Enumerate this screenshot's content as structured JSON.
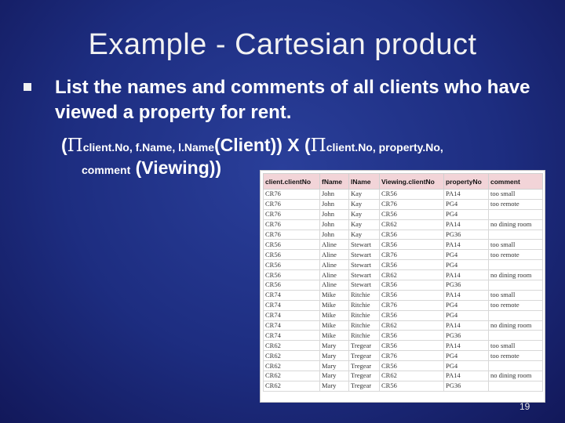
{
  "title": "Example - Cartesian product",
  "bullet": "List the names and comments of all clients who have viewed a property for rent.",
  "expression": {
    "open1": "(",
    "pi": "Π",
    "proj1_attrs": "client.No, f.Name, l.Name",
    "rel1": "(Client)) X (",
    "proj2_attrs": "client.No, property.No,",
    "proj2_attrs_cont": "comment",
    "rel2": "(Viewing))"
  },
  "table": {
    "headers": [
      "client.clientNo",
      "fName",
      "lName",
      "Viewing.clientNo",
      "propertyNo",
      "comment"
    ],
    "rows": [
      [
        "CR76",
        "John",
        "Kay",
        "CR56",
        "PA14",
        "too small"
      ],
      [
        "CR76",
        "John",
        "Kay",
        "CR76",
        "PG4",
        "too remote"
      ],
      [
        "CR76",
        "John",
        "Kay",
        "CR56",
        "PG4",
        ""
      ],
      [
        "CR76",
        "John",
        "Kay",
        "CR62",
        "PA14",
        "no dining room"
      ],
      [
        "CR76",
        "John",
        "Kay",
        "CR56",
        "PG36",
        ""
      ],
      [
        "CR56",
        "Aline",
        "Stewart",
        "CR56",
        "PA14",
        "too small"
      ],
      [
        "CR56",
        "Aline",
        "Stewart",
        "CR76",
        "PG4",
        "too remote"
      ],
      [
        "CR56",
        "Aline",
        "Stewart",
        "CR56",
        "PG4",
        ""
      ],
      [
        "CR56",
        "Aline",
        "Stewart",
        "CR62",
        "PA14",
        "no dining room"
      ],
      [
        "CR56",
        "Aline",
        "Stewart",
        "CR56",
        "PG36",
        ""
      ],
      [
        "CR74",
        "Mike",
        "Ritchie",
        "CR56",
        "PA14",
        "too small"
      ],
      [
        "CR74",
        "Mike",
        "Ritchie",
        "CR76",
        "PG4",
        "too remote"
      ],
      [
        "CR74",
        "Mike",
        "Ritchie",
        "CR56",
        "PG4",
        ""
      ],
      [
        "CR74",
        "Mike",
        "Ritchie",
        "CR62",
        "PA14",
        "no dining room"
      ],
      [
        "CR74",
        "Mike",
        "Ritchie",
        "CR56",
        "PG36",
        ""
      ],
      [
        "CR62",
        "Mary",
        "Tregear",
        "CR56",
        "PA14",
        "too small"
      ],
      [
        "CR62",
        "Mary",
        "Tregear",
        "CR76",
        "PG4",
        "too remote"
      ],
      [
        "CR62",
        "Mary",
        "Tregear",
        "CR56",
        "PG4",
        ""
      ],
      [
        "CR62",
        "Mary",
        "Tregear",
        "CR62",
        "PA14",
        "no dining room"
      ],
      [
        "CR62",
        "Mary",
        "Tregear",
        "CR56",
        "PG36",
        ""
      ]
    ]
  },
  "page_number": "19",
  "colors": {
    "background": "#1d2d80",
    "table_header": "#f2d4d8"
  }
}
